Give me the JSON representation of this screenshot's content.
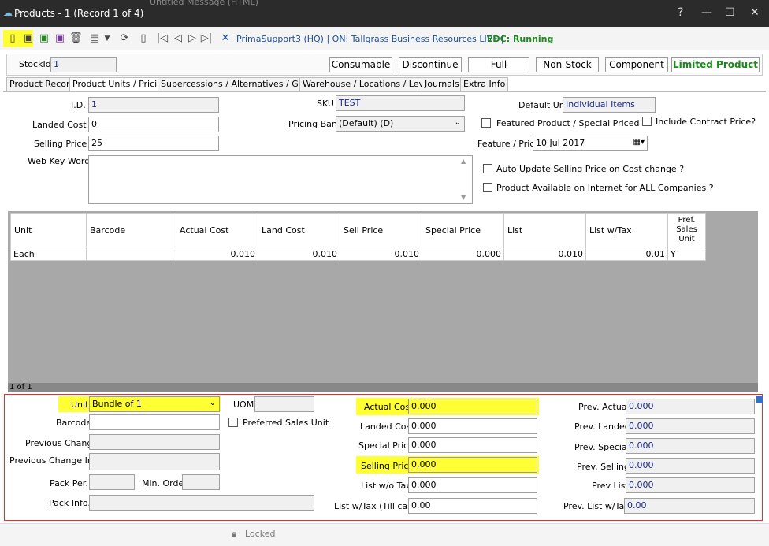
{
  "window": {
    "title": "Products - 1  (Record 1 of 4)",
    "ghost_tabs": "Untitled     Message (HTML)",
    "controls": [
      "?",
      "—",
      "☐",
      "✕"
    ]
  },
  "toolbar": {
    "context_text": "PrimaSupport3  (HQ) | ON: Tallgrass Business Resources LIVE |",
    "edc_text": "EDC: Running"
  },
  "header": {
    "stock_id_label": "StockId",
    "stock_id_value": "1",
    "buttons": [
      "Consumable",
      "Discontinue",
      "Full",
      "Non-Stock",
      "Component"
    ],
    "status": "Limited Product"
  },
  "tabs": [
    "Product Record",
    "Product Units / Pricing",
    "Supercessions / Alternatives / Groups",
    "Warehouse / Locations / Levels",
    "Journals",
    "Extra Info"
  ],
  "form": {
    "id_label": "I.D.",
    "id_value": "1",
    "landed_label": "Landed Cost %",
    "landed_value": "0",
    "selling_label": "Selling Price %",
    "selling_value": "25",
    "webkey_label": "Web Key Words",
    "webkey_value": "",
    "sku_label": "SKU",
    "sku_value": "TEST",
    "pricing_label": "Pricing Band",
    "pricing_value": "(Default)    (D)",
    "default_unit_label": "Default Unit",
    "default_unit_value": "Individual Items",
    "featured_label": "Featured Product / Special Priced ?",
    "contract_label": "Include Contract Price?",
    "feature_price_label": "Feature / Price",
    "feature_price_value": "10 Jul 2017",
    "auto_update_label": "Auto Update Selling Price on Cost change ?",
    "internet_label": "Product Available on Internet for ALL Companies ?"
  },
  "grid": {
    "columns": [
      "Unit",
      "Barcode",
      "Actual Cost",
      "Land Cost",
      "Sell Price",
      "Special Price",
      "List",
      "List w/Tax",
      "Pref. Sales Unit"
    ],
    "rows": [
      [
        "Each",
        "",
        "0.010",
        "0.010",
        "0.010",
        "0.000",
        "0.010",
        "0.01",
        "Y"
      ]
    ],
    "footer": "1 of 1"
  },
  "detail": {
    "unit_label": "Unit",
    "unit_value": "Bundle of 1",
    "uom_label": "UOM",
    "uom_value": "",
    "barcode_label": "Barcode",
    "barcode_value": "",
    "preferred_label": "Preferred Sales Unit",
    "prev_change_label": "Previous Change",
    "prev_change_value": "",
    "prev_change_info_label": "Previous Change Info",
    "prev_change_info_value": "",
    "pack_per_label": "Pack Per.",
    "pack_per_value": "",
    "min_order_label": "Min. Order",
    "min_order_value": "",
    "pack_info_label": "Pack Info.",
    "pack_info_value": "",
    "actual_cost_label": "Actual Cost",
    "actual_cost_value": "0.000",
    "landed_cost_label": "Landed Cost",
    "landed_cost_value": "0.000",
    "special_price_label": "Special Price",
    "special_price_value": "0.000",
    "selling_price_label": "Selling Price",
    "selling_price_value": "0.000",
    "list_wo_tax_label": "List w/o Tax",
    "list_wo_tax_value": "0.000",
    "list_w_tax_label": "List w/Tax (Till cash",
    "list_w_tax_value": "0.00",
    "prev_actual_label": "Prev. Actual",
    "prev_actual_value": "0.000",
    "prev_landed_label": "Prev. Landed",
    "prev_landed_value": "0.000",
    "prev_special_label": "Prev. Special",
    "prev_special_value": "0.000",
    "prev_selling_label": "Prev. Selling",
    "prev_selling_value": "0.000",
    "prev_list_label": "Prev List",
    "prev_list_value": "0.000",
    "prev_list_tax_label": "Prev. List w/Tax",
    "prev_list_tax_value": "0.00"
  },
  "status": {
    "locked": "Locked"
  },
  "colors": {
    "highlight": "#ffff33",
    "edc": "#1a8a1a",
    "limited": "#1a8a1a",
    "frame": "#e03030"
  }
}
